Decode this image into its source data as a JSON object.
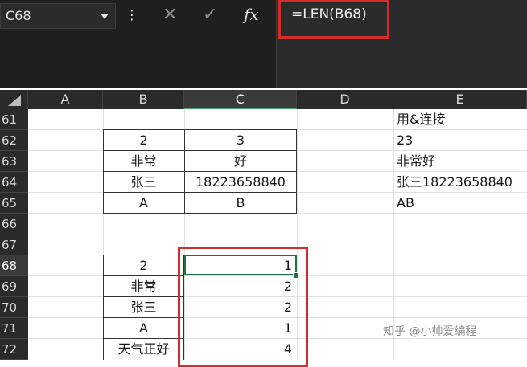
{
  "name_box": {
    "value": "C68"
  },
  "formula_bar": {
    "cancel_icon": "✕",
    "enter_icon": "✓",
    "fx_label": "fx",
    "more_icon": "⋮",
    "formula": "=LEN(B68)"
  },
  "columns": [
    "A",
    "B",
    "C",
    "D",
    "E"
  ],
  "selected_column": "C",
  "rows": [
    "61",
    "62",
    "63",
    "64",
    "65",
    "66",
    "67",
    "68",
    "69",
    "70",
    "71",
    "72"
  ],
  "selected_row": "68",
  "cells": {
    "E61": "用&连接",
    "B62": "2",
    "C62": "3",
    "E62": "23",
    "B63": "非常",
    "C63": "好",
    "E63": "非常好",
    "B64": "张三",
    "C64": "18223658840",
    "E64": "张三18223658840",
    "B65": "A",
    "C65": "B",
    "E65": "AB",
    "B68": "2",
    "C68": "1",
    "B69": "非常",
    "C69": "2",
    "B70": "张三",
    "C70": "2",
    "B71": "A",
    "C71": "1",
    "B72": "天气正好",
    "C72": "4"
  },
  "watermark": "知乎 @小帅爱编程",
  "colors": {
    "highlight": "#d42b2b",
    "active_cell": "#1e7145",
    "chrome": "#1f1f1f"
  }
}
